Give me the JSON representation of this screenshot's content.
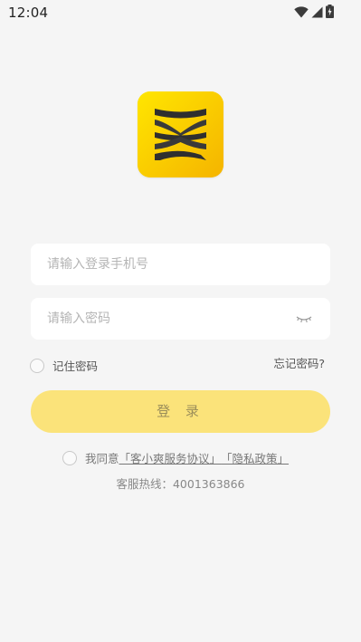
{
  "status_bar": {
    "time": "12:04",
    "icons": [
      "wifi-icon",
      "signal-icon",
      "battery-icon"
    ]
  },
  "app": {
    "logo_icon": "app-logo-icon",
    "brand_colors": {
      "logo_yellow": "#ffd000",
      "button_yellow": "#fbe37a"
    }
  },
  "login_form": {
    "phone_placeholder": "请输入登录手机号",
    "phone_value": "",
    "password_placeholder": "请输入密码",
    "password_value": "",
    "password_visibility_icon": "eye-closed-icon",
    "remember_label": "记住密码",
    "forgot_label": "忘记密码?",
    "login_label": "登 录"
  },
  "agreement": {
    "prefix": "我同意",
    "service_link": "「客小爽服务协议」",
    "privacy_link": "「隐私政策」"
  },
  "hotline": "客服热线：4001363866"
}
